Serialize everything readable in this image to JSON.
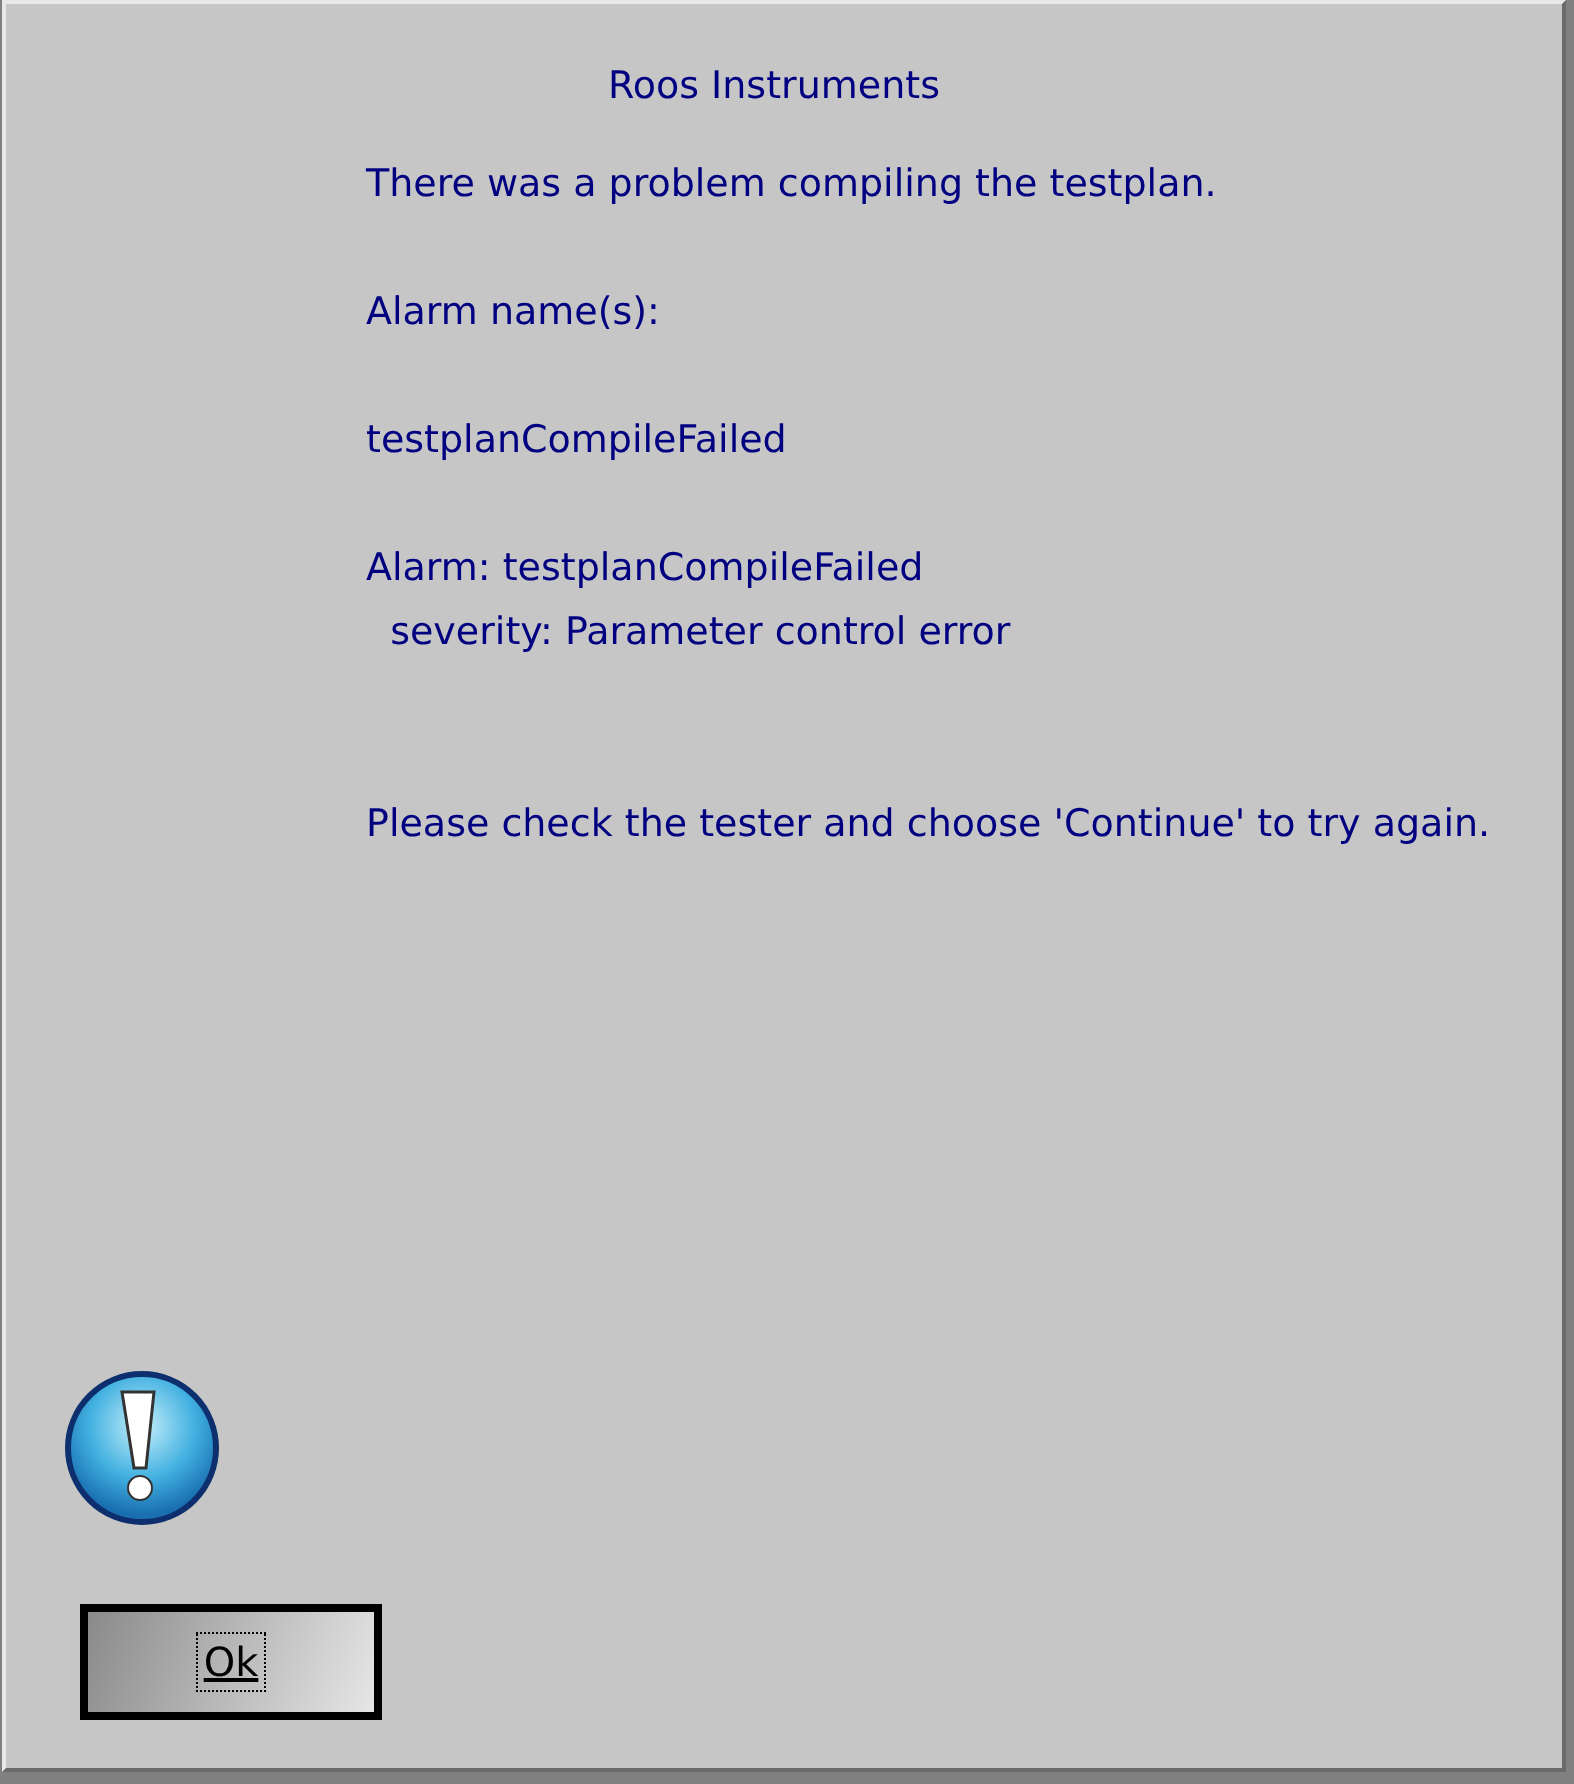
{
  "dialog": {
    "title": "Roos Instruments",
    "paragraphs": [
      "There was a problem compiling the testplan.",
      "Alarm name(s):",
      "testplanCompileFailed",
      "Alarm: testplanCompileFailed\n  severity: Parameter control error",
      "Please check the tester and choose 'Continue' to try again."
    ],
    "buttons": [
      {
        "label": "Ok",
        "focused": true
      }
    ]
  }
}
